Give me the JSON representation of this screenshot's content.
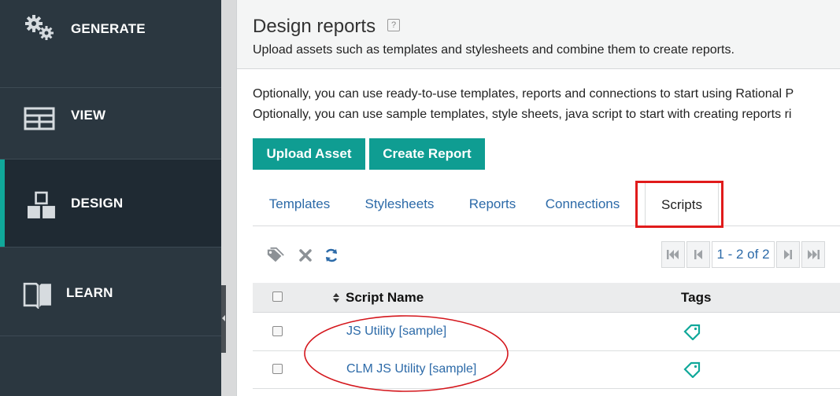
{
  "sidebar": {
    "items": [
      {
        "label": "GENERATE",
        "icon": "gears-icon"
      },
      {
        "label": "VIEW",
        "icon": "layout-grid-icon"
      },
      {
        "label": "DESIGN",
        "icon": "blocks-icon",
        "active": true
      },
      {
        "label": "LEARN",
        "icon": "book-icon"
      }
    ]
  },
  "header": {
    "title": "Design reports",
    "subtitle": "Upload assets such as templates and stylesheets and combine them to create reports."
  },
  "info": {
    "line1": "Optionally, you can use ready-to-use templates, reports and connections to start using Rational P",
    "line2": "Optionally, you can use sample templates, style sheets, java script to start with creating reports ri"
  },
  "buttons": {
    "upload": "Upload Asset",
    "create": "Create Report"
  },
  "tabs": [
    {
      "label": "Templates"
    },
    {
      "label": "Stylesheets"
    },
    {
      "label": "Reports"
    },
    {
      "label": "Connections"
    },
    {
      "label": "Scripts",
      "active": true
    }
  ],
  "pager": {
    "label": "1 - 2 of 2"
  },
  "table": {
    "columns": {
      "name": "Script Name",
      "tags": "Tags"
    },
    "rows": [
      {
        "name": "JS Utility [sample]"
      },
      {
        "name": "CLM JS Utility [sample]"
      }
    ]
  },
  "colors": {
    "accent": "#0f9d92",
    "link": "#2c6aa8",
    "sidebar": "#2b3740",
    "highlight": "#e01b1b"
  }
}
